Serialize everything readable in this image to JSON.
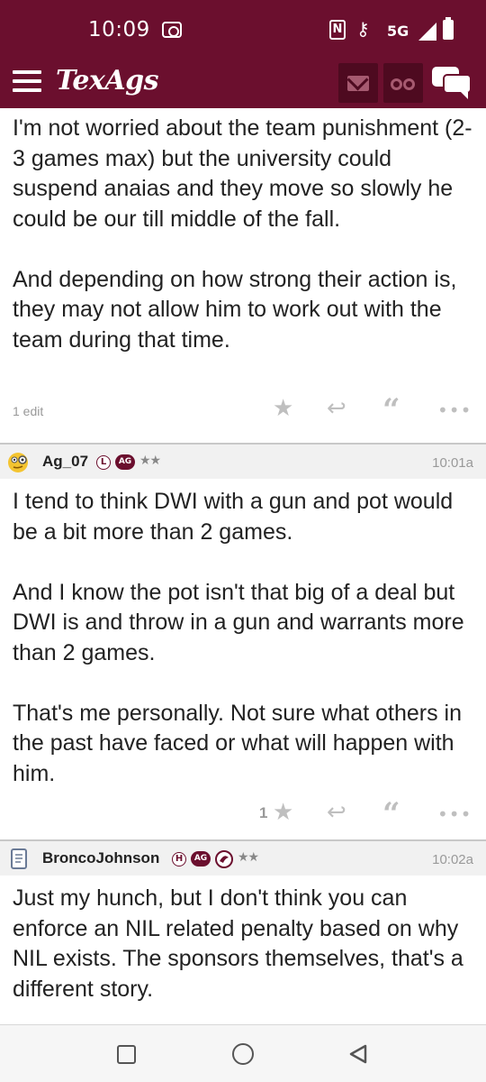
{
  "status_bar": {
    "time": "10:09",
    "network": "5G",
    "nfc_label": "N"
  },
  "header": {
    "logo": "TexAgs"
  },
  "posts": [
    {
      "body": "I'm not worried about the team punishment (2-3 games max) but the university could suspend anaias and they move so slowly he could be our till middle of the fall.\n\nAnd depending on how strong their action is, they may not allow him to work out with the team during that time.",
      "edit_note": "1 edit",
      "like_count": ""
    },
    {
      "username": "Ag_07",
      "badges": [
        "L",
        "AG"
      ],
      "stars": "★★",
      "time": "10:01a",
      "body": "I tend to think DWI with a gun and pot would be a bit more than 2 games.\n\nAnd I know the pot isn't that big of a deal but DWI is and throw in a gun and warrants more than 2 games.\n\nThat's me personally. Not sure what others in the past have faced or what will happen with him.",
      "like_count": "1"
    },
    {
      "username": "BroncoJohnson",
      "badges": [
        "H",
        "AG"
      ],
      "stars": "★★",
      "time": "10:02a",
      "body": "Just my hunch, but I don't think you can enforce an NIL related penalty based on why NIL exists. The sponsors themselves, that's a different story."
    }
  ],
  "icons": {
    "like": "★",
    "reply": "↩",
    "quote": "“",
    "more": "•••"
  },
  "colors": {
    "brand": "#6b0f2e",
    "header_dark": "#4e0a20",
    "muted": "#bfbfbf"
  }
}
